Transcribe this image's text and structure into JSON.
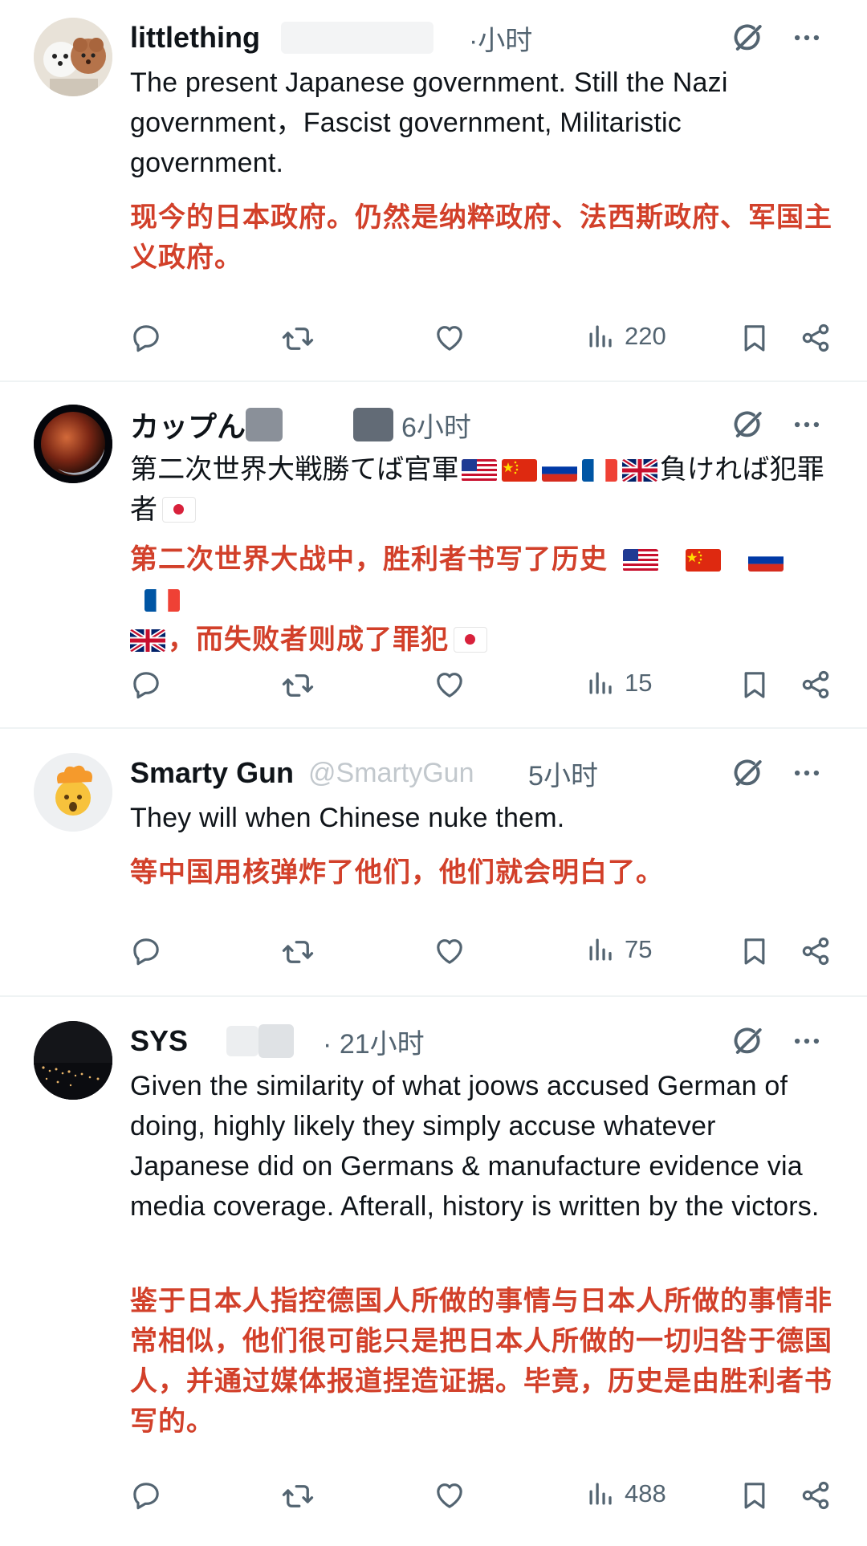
{
  "posts": [
    {
      "name": "littlething",
      "time": "·小时",
      "text_en": "The present Japanese government. Still the Nazi government，Fascist government, Militaristic government.",
      "text_zh": "现今的日本政府。仍然是纳粹政府、法西斯政府、军国主义政府。",
      "views": "220",
      "avatar": "two-dogs-avatar"
    },
    {
      "name": "カップん",
      "time": "6小时",
      "text_jp_a": "第二次世界大戦勝てば官軍",
      "text_jp_b": "負ければ犯罪者",
      "text_zh_a": "第二次世界大战中，胜利者书写了历史",
      "text_zh_b": "，而失败者则成了罪犯",
      "views": "15",
      "avatar": "lunar-eclipse-avatar"
    },
    {
      "name": "Smarty Gun",
      "handle": "@SmartyGun",
      "time": "5小时",
      "text_en": "They will when Chinese nuke them.",
      "text_zh": "等中国用核弹炸了他们，他们就会明白了。",
      "views": "75",
      "avatar": "exploding-head-emoji-avatar"
    },
    {
      "name": "SYS",
      "time": "· 21小时",
      "text_en": "Given the similarity of what joows accused German of doing, highly likely they simply accuse whatever Japanese did on Germans & manufacture evidence via media coverage. Afterall, history is written by the victors.",
      "text_zh": "鉴于日本人指控德国人所做的事情与日本人所做的事情非常相似，他们很可能只是把日本人所做的一切归咎于德国人，并通过媒体报道捏造证据。毕竟，历史是由胜利者书写的。",
      "views": "488",
      "avatar": "night-city-avatar"
    }
  ],
  "icons": {
    "header": [
      "grok-icon",
      "more-icon"
    ],
    "actions": [
      "reply-icon",
      "retweet-icon",
      "like-icon",
      "views-icon",
      "bookmark-icon",
      "share-icon"
    ]
  },
  "flags": [
    "us-flag",
    "china-flag",
    "russia-flag",
    "france-flag",
    "uk-flag",
    "japan-flag"
  ],
  "colors": {
    "text": "#0f1419",
    "secondary": "#536471",
    "translation": "#d2402a",
    "divider": "#eff3f4"
  }
}
